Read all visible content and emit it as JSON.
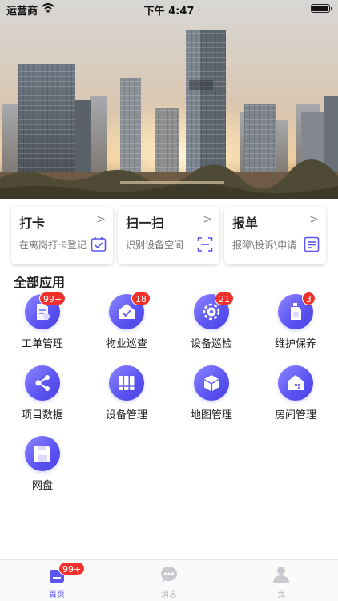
{
  "status_bar": {
    "carrier": "运营商",
    "time": "下午 4:47"
  },
  "quick_cards": [
    {
      "title": "打卡",
      "subtitle": "在离岗打卡登记",
      "icon": "calendar-check-icon"
    },
    {
      "title": "扫一扫",
      "subtitle": "识别设备空间",
      "icon": "scan-icon"
    },
    {
      "title": "报单",
      "subtitle": "报障\\投诉\\申请",
      "icon": "document-list-icon"
    }
  ],
  "section_title": "全部应用",
  "apps": [
    {
      "label": "工单管理",
      "icon": "work-order-icon",
      "badge": "99+"
    },
    {
      "label": "物业巡查",
      "icon": "house-check-icon",
      "badge": "18"
    },
    {
      "label": "设备巡检",
      "icon": "gear-inspect-icon",
      "badge": "21"
    },
    {
      "label": "维护保养",
      "icon": "oil-bottle-icon",
      "badge": "3"
    },
    {
      "label": "项目数据",
      "icon": "share-nodes-icon",
      "badge": ""
    },
    {
      "label": "设备管理",
      "icon": "binders-icon",
      "badge": ""
    },
    {
      "label": "地图管理",
      "icon": "cube-icon",
      "badge": ""
    },
    {
      "label": "房间管理",
      "icon": "house-icon",
      "badge": ""
    },
    {
      "label": "网盘",
      "icon": "floppy-disk-icon",
      "badge": ""
    }
  ],
  "tabbar": [
    {
      "label": "首页",
      "icon": "home-icon",
      "badge": "99+",
      "active": true
    },
    {
      "label": "消息",
      "icon": "chat-bubble-icon",
      "badge": "",
      "active": false
    },
    {
      "label": "我",
      "icon": "person-icon",
      "badge": "",
      "active": false
    }
  ],
  "colors": {
    "accent": "#5a53f2",
    "badge": "#f0302b"
  }
}
